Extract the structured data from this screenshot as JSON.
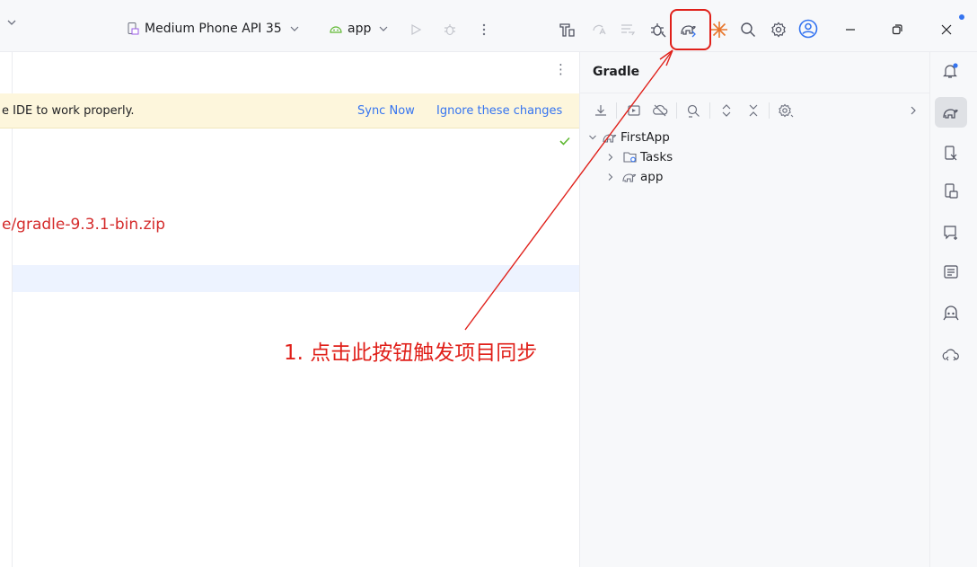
{
  "toolbar": {
    "device_label": "Medium Phone API 35",
    "run_config_label": "app",
    "icons": [
      "dropdown-chevron",
      "device-icon",
      "android-icon",
      "run-icon",
      "debug-icon",
      "more-icon",
      "build-icon",
      "apply-changes-icon",
      "apply-code-changes-icon",
      "profiler-icon",
      "gradle-sync-icon",
      "gemini-icon",
      "search-icon",
      "settings-icon",
      "account-icon",
      "minimize-icon",
      "restore-icon",
      "close-icon"
    ]
  },
  "editor": {
    "banner_text": "e IDE to work properly.",
    "sync_now": "Sync Now",
    "ignore_changes": "Ignore these changes",
    "distribution_url_text": "e/gradle-9.3.1-bin.zip",
    "menu_icon": "⋮"
  },
  "gradle_panel": {
    "title": "Gradle",
    "tree": [
      {
        "label": "FirstApp",
        "expanded": true
      },
      {
        "label": "Tasks",
        "expanded": false
      },
      {
        "label": "app",
        "expanded": false
      }
    ]
  },
  "annotation": {
    "text": "1. 点击此按钮触发项目同步",
    "color": "#e0201a"
  },
  "colors": {
    "accent": "#3574f0",
    "banner_bg": "#fdf6dc",
    "error_text": "#d42a2a",
    "check_green": "#5fb832"
  }
}
